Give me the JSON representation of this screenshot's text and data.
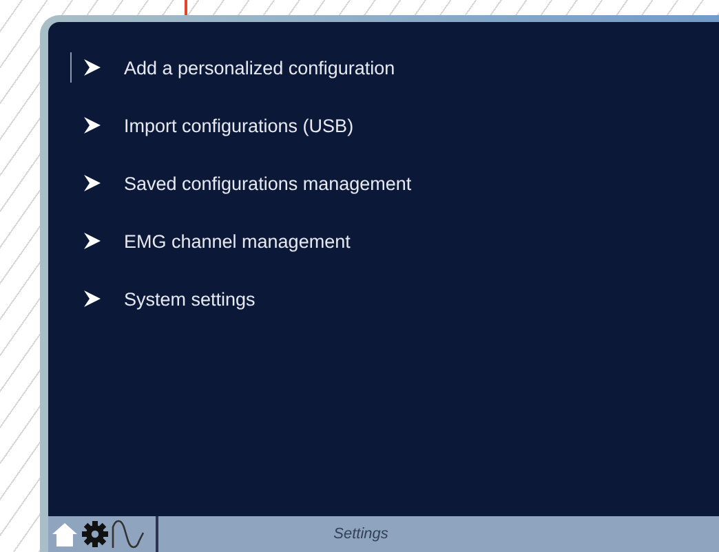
{
  "menu": [
    {
      "label": "Add a personalized configuration",
      "selected": true
    },
    {
      "label": "Import configurations (USB)",
      "selected": false
    },
    {
      "label": "Saved configurations management",
      "selected": false
    },
    {
      "label": "EMG channel management",
      "selected": false
    },
    {
      "label": "System settings",
      "selected": false
    }
  ],
  "status_bar": {
    "title": "Settings"
  }
}
